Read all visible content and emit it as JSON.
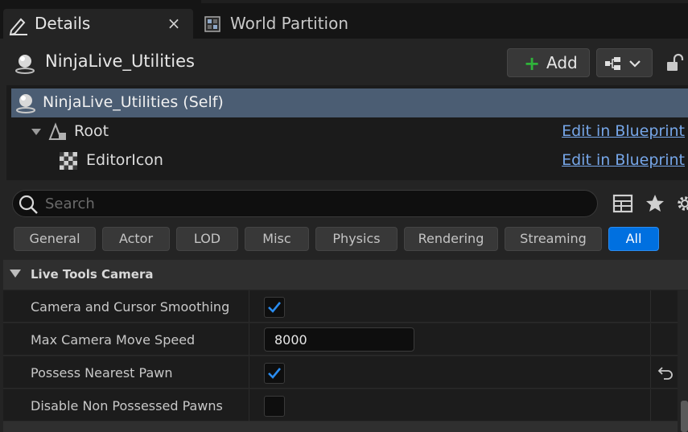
{
  "tabs": [
    {
      "label": "Details",
      "icon": "pencil-icon",
      "close": "×"
    },
    {
      "label": "World Partition",
      "icon": "grid-map-icon"
    }
  ],
  "actor": {
    "name": "NinjaLive_Utilities",
    "icon": "actor-sphere-icon"
  },
  "toolbar": {
    "add_label": "Add",
    "add_icon": "+"
  },
  "components": [
    {
      "label": "NinjaLive_Utilities (Self)"
    },
    {
      "label": "Root",
      "link": "Edit in Blueprint"
    },
    {
      "label": "EditorIcon",
      "link": "Edit in Blueprint"
    }
  ],
  "search": {
    "placeholder": "Search"
  },
  "filters": [
    "General",
    "Actor",
    "LOD",
    "Misc",
    "Physics",
    "Rendering",
    "Streaming",
    "All"
  ],
  "active_filter": "All",
  "category": {
    "title": "Live Tools Camera"
  },
  "properties": [
    {
      "name": "Camera and Cursor Smoothing",
      "type": "checkbox",
      "checked": true
    },
    {
      "name": "Max Camera Move Speed",
      "type": "number",
      "value": "8000"
    },
    {
      "name": "Possess Nearest Pawn",
      "type": "checkbox",
      "checked": true
    },
    {
      "name": "Disable Non Possessed Pawns",
      "type": "checkbox",
      "checked": false
    }
  ],
  "colors": {
    "accent": "#0070e0",
    "selection": "#4b5d73",
    "link": "#76a6e8",
    "add_plus": "#2fb33a"
  }
}
